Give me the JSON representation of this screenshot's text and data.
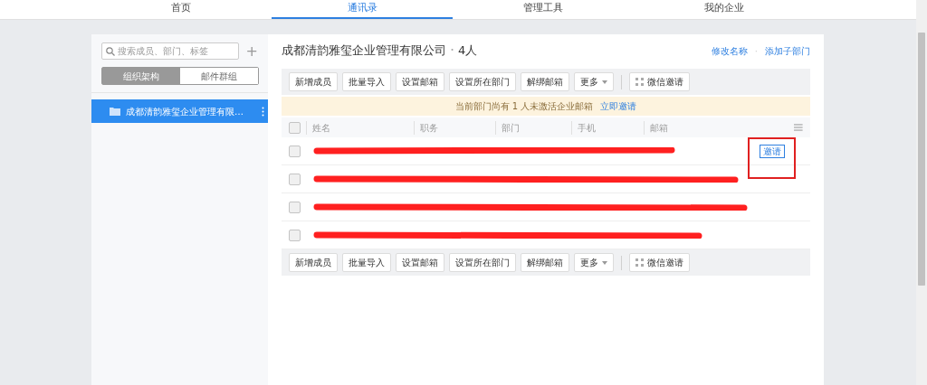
{
  "nav": {
    "tabs": [
      {
        "label": "首页",
        "selected": false
      },
      {
        "label": "通讯录",
        "selected": true
      },
      {
        "label": "管理工具",
        "selected": false
      },
      {
        "label": "我的企业",
        "selected": false
      }
    ]
  },
  "sidebar": {
    "search": {
      "placeholder": "搜索成员、部门、标签"
    },
    "add": "+",
    "segments": [
      {
        "label": "组织架构",
        "selected": true
      },
      {
        "label": "邮件群组",
        "selected": false
      }
    ],
    "items": [
      {
        "label": "成都清韵雅玺企业管理有限…",
        "selected": true
      }
    ]
  },
  "main": {
    "title": "成都清韵雅玺企业管理有限公司",
    "separator": "·",
    "count": "4人",
    "link_separator": "·",
    "links": [
      "修改名称",
      "添加子部门"
    ],
    "toolbar": [
      "新增成员",
      "批量导入",
      "设置邮箱",
      "设置所在部门",
      "解绑邮箱",
      "更多",
      "微信邀请"
    ],
    "notice": {
      "text": "当前部门尚有 1 人未激活企业邮箱",
      "link": "立即邀请"
    },
    "table": {
      "columns": [
        "姓名",
        "职务",
        "部门",
        "手机",
        "邮箱"
      ],
      "select_all": false,
      "rows": [
        {
          "checked": false,
          "invite": "邀请"
        },
        {
          "checked": false
        },
        {
          "checked": false
        },
        {
          "checked": false
        }
      ]
    },
    "bottom_toolbar": [
      "新增成员",
      "批量导入",
      "设置邮箱",
      "设置所在部门",
      "解绑邮箱",
      "更多",
      "微信邀请"
    ]
  }
}
